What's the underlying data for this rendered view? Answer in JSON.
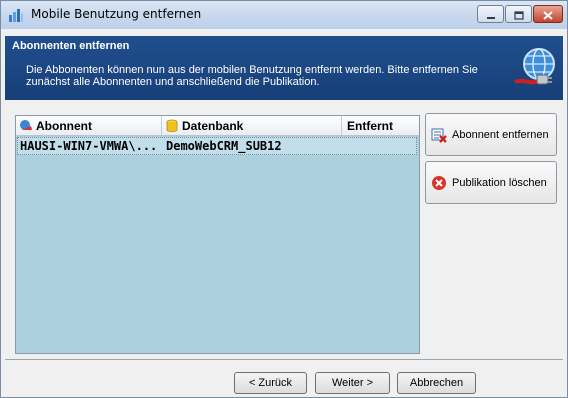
{
  "window": {
    "title": "Mobile Benutzung entfernen",
    "title_icon": "database-window-icon"
  },
  "titlebar_buttons": {
    "minimize": "–",
    "maximize": "□",
    "close": "✕"
  },
  "header": {
    "title": "Abonnenten entfernen",
    "description": "Die Abbonenten können nun aus der mobilen Benutzung entfernt werden. Bitte entfernen Sie zunächst alle Abonnenten und anschließend die Publikation.",
    "graphic": "network-globe-icon"
  },
  "grid": {
    "columns": [
      {
        "label": "Abonnent",
        "icon": "subscriber-icon"
      },
      {
        "label": "Datenbank",
        "icon": "database-icon"
      },
      {
        "label": "Entfernt"
      }
    ],
    "rows": [
      {
        "abonnent": "HAUSI-WIN7-VMWA\\...",
        "datenbank": "DemoWebCRM_SUB12",
        "entfernt": ""
      }
    ]
  },
  "actions": {
    "remove_subscriber": {
      "label": "Abonnent entfernen",
      "icon": "remove-subscriber-icon"
    },
    "delete_publication": {
      "label": "Publikation löschen",
      "icon": "delete-icon"
    }
  },
  "nav": {
    "back": "< Zurück",
    "next": "Weiter >",
    "cancel": "Abbrechen"
  },
  "colors": {
    "header": "#1c4a8a",
    "grid_background": "#add0df",
    "selected_row": "#c1deea",
    "close_button": "#c4452b"
  }
}
